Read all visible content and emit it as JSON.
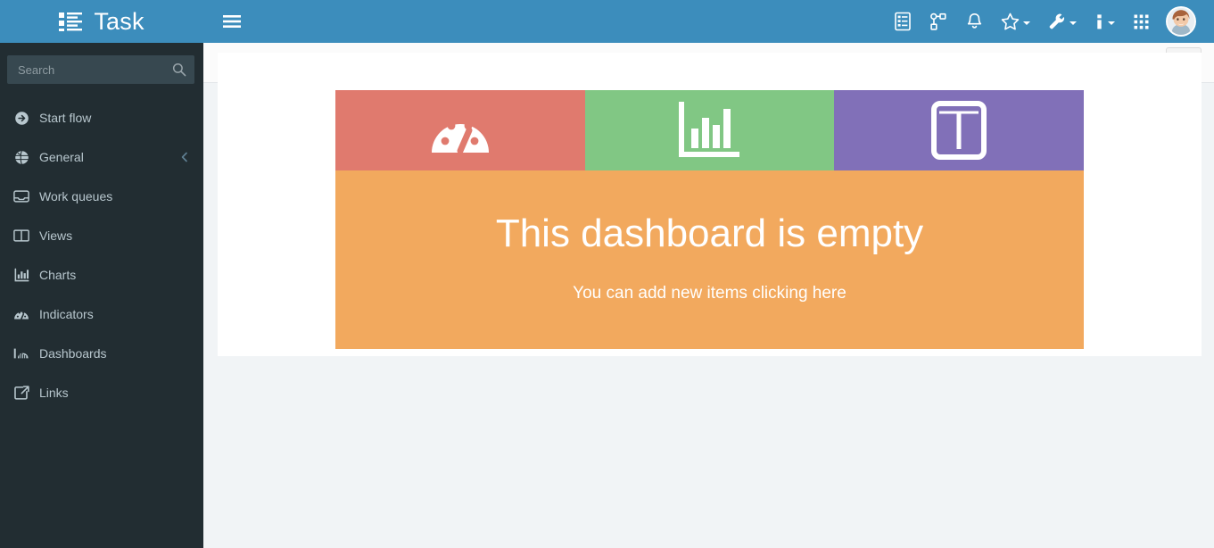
{
  "brand": {
    "title": "Task",
    "logo_icon": "list-tasks-icon",
    "bar_color": "#3C8DBC"
  },
  "sidebar": {
    "background_color": "#222D32",
    "search": {
      "placeholder": "Search",
      "value": "",
      "icon": "search-icon"
    },
    "items": [
      {
        "label": "Start flow",
        "icon": "arrow-circle-right-icon",
        "has_arrow": false
      },
      {
        "label": "General",
        "icon": "globe-icon",
        "has_arrow": true,
        "arrow_icon": "chevron-left-icon"
      },
      {
        "label": "Work queues",
        "icon": "inbox-icon",
        "has_arrow": false
      },
      {
        "label": "Views",
        "icon": "columns-icon",
        "has_arrow": false
      },
      {
        "label": "Charts",
        "icon": "bar-chart-icon",
        "has_arrow": false
      },
      {
        "label": "Indicators",
        "icon": "tachometer-icon",
        "has_arrow": false
      },
      {
        "label": "Dashboards",
        "icon": "dashboard-icon",
        "has_arrow": false
      },
      {
        "label": "Links",
        "icon": "external-link-icon",
        "has_arrow": false
      }
    ]
  },
  "navbar": {
    "toggle_icon": "hamburger-menu-icon",
    "actions": [
      {
        "name": "tasks",
        "icon": "tasks-list-icon",
        "caret": false
      },
      {
        "name": "sitemap",
        "icon": "sitemap-icon",
        "caret": false
      },
      {
        "name": "notifications",
        "icon": "bell-icon",
        "caret": false
      },
      {
        "name": "favorites",
        "icon": "star-icon",
        "caret": true
      },
      {
        "name": "tools",
        "icon": "wrench-icon",
        "caret": true
      },
      {
        "name": "info",
        "icon": "info-icon",
        "caret": true
      },
      {
        "name": "apps",
        "icon": "grid-apps-icon",
        "caret": false
      }
    ],
    "avatar": {
      "name": "user-avatar"
    }
  },
  "content": {
    "header": {
      "edit_button": {
        "icon": "pencil-icon",
        "label": ""
      }
    },
    "tiles": [
      {
        "name": "indicator-tile",
        "icon": "tachometer-icon",
        "color": "#E07A6E"
      },
      {
        "name": "chart-tile",
        "icon": "bar-chart-icon",
        "color": "#81C784"
      },
      {
        "name": "view-tile",
        "icon": "columns-icon",
        "color": "#8170B8"
      }
    ],
    "empty_state": {
      "title": "This dashboard is empty",
      "subtitle": "You can add new items clicking here",
      "color": "#F2A95E"
    }
  }
}
